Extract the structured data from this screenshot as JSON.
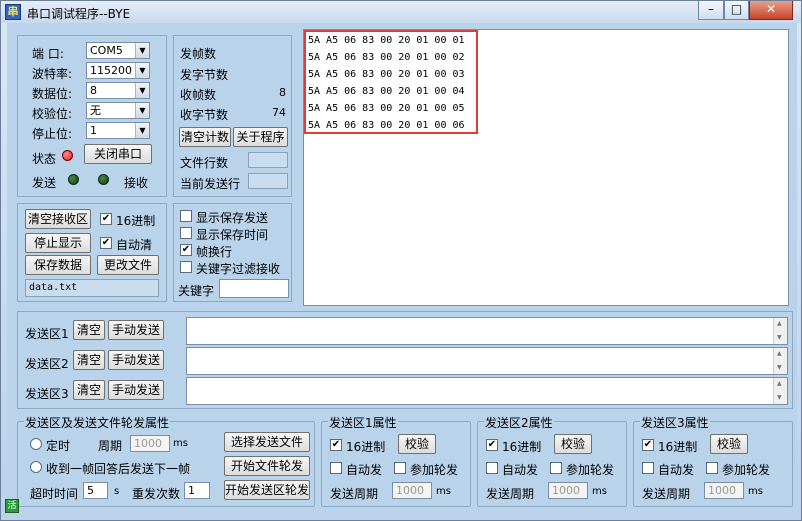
{
  "window": {
    "title": "串口调试程序--BYE"
  },
  "serial": {
    "port_label": "端  口:",
    "port_value": "COM5",
    "baud_label": "波特率:",
    "baud_value": "115200",
    "databits_label": "数据位:",
    "databits_value": "8",
    "parity_label": "校验位:",
    "parity_value": "无",
    "stopbits_label": "停止位:",
    "stopbits_value": "1",
    "status_label": "状态",
    "status_color": "#e02020",
    "close_port_button": "关闭串口",
    "send_label": "发送",
    "recv_label": "接收"
  },
  "stats": {
    "sent_frames_label": "发帧数",
    "sent_frames_value": "",
    "sent_bytes_label": "发字节数",
    "sent_bytes_value": "",
    "recv_frames_label": "收帧数",
    "recv_frames_value": "8",
    "recv_bytes_label": "收字节数",
    "recv_bytes_value": "74",
    "clear_count_button": "清空计数",
    "about_button": "关于程序",
    "file_lines_label": "文件行数",
    "current_line_label": "当前发送行"
  },
  "receive_controls": {
    "clear_button": "清空接收区",
    "hex_label": "16进制",
    "hex_checked": true,
    "stop_display_button": "停止显示",
    "auto_clear_label": "自动清",
    "auto_clear_checked": true,
    "save_data_button": "保存数据",
    "change_file_button": "更改文件",
    "filename": "data.txt"
  },
  "display_options": {
    "show_save_send_label": "显示保存发送",
    "show_save_send_checked": false,
    "show_save_time_label": "显示保存时间",
    "show_save_time_checked": false,
    "frame_newline_label": "帧换行",
    "frame_newline_checked": true,
    "keyword_filter_label": "关键字过滤接收",
    "keyword_filter_checked": false,
    "keyword_label": "关键字",
    "keyword_value": ""
  },
  "receive": {
    "lines": [
      "5A A5 06 83 00 20 01 00 01",
      "5A A5 06 83 00 20 01 00 02",
      "5A A5 06 83 00 20 01 00 03",
      "5A A5 06 83 00 20 01 00 04",
      "5A A5 06 83 00 20 01 00 05",
      "5A A5 06 83 00 20 01 00 06"
    ]
  },
  "send_areas": [
    {
      "label": "发送区1",
      "clear_button": "清空",
      "manual_button": "手动发送",
      "content": ""
    },
    {
      "label": "发送区2",
      "clear_button": "清空",
      "manual_button": "手动发送",
      "content": ""
    },
    {
      "label": "发送区3",
      "clear_button": "清空",
      "manual_button": "手动发送",
      "content": ""
    }
  ],
  "rotation": {
    "group_title": "发送区及发送文件轮发属性",
    "timed_label": "定时",
    "period_label": "周期",
    "period_value": "1000",
    "period_unit": "ms",
    "after_reply_label": "收到一帧回答后发送下一帧",
    "timeout_label": "超时时间",
    "timeout_value": "5",
    "timeout_unit": "s",
    "resend_label": "重发次数",
    "resend_value": "1",
    "select_file_button": "选择发送文件",
    "start_file_button": "开始文件轮发",
    "start_area_button": "开始发送区轮发"
  },
  "area_props": [
    {
      "title": "发送区1属性",
      "hex_label": "16进制",
      "hex_checked": true,
      "check_button": "校验",
      "auto_label": "自动发",
      "auto_checked": false,
      "join_label": "参加轮发",
      "join_checked": false,
      "period_label": "发送周期",
      "period_value": "1000",
      "unit": "ms"
    },
    {
      "title": "发送区2属性",
      "hex_label": "16进制",
      "hex_checked": true,
      "check_button": "校验",
      "auto_label": "自动发",
      "auto_checked": false,
      "join_label": "参加轮发",
      "join_checked": false,
      "period_label": "发送周期",
      "period_value": "1000",
      "unit": "ms"
    },
    {
      "title": "发送区3属性",
      "hex_label": "16进制",
      "hex_checked": true,
      "check_button": "校验",
      "auto_label": "自动发",
      "auto_checked": false,
      "join_label": "参加轮发",
      "join_checked": false,
      "period_label": "发送周期",
      "period_value": "1000",
      "unit": "ms"
    }
  ],
  "status_bar": {
    "icon_text": "活"
  }
}
